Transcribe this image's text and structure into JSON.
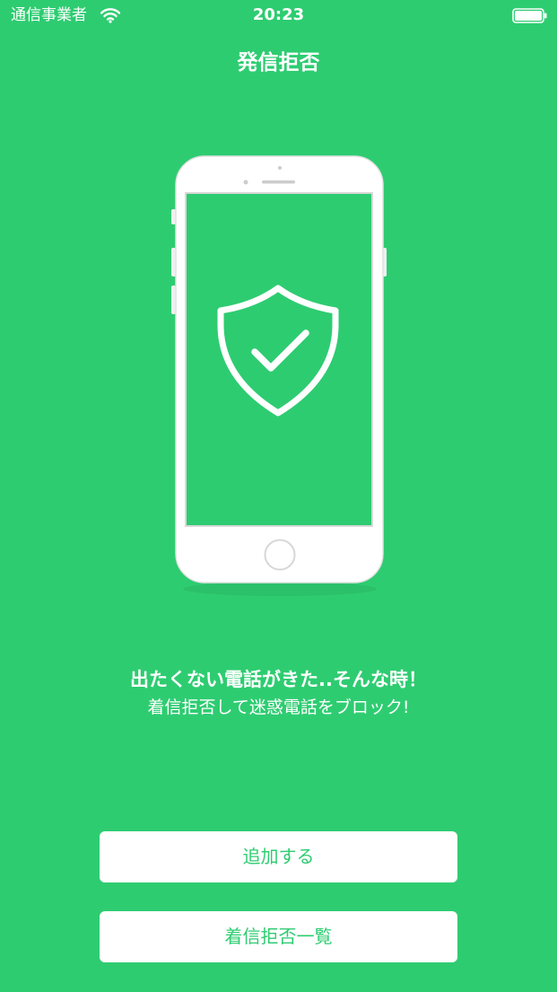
{
  "status_bar": {
    "carrier": "通信事業者",
    "time": "20:23",
    "wifi_icon": "wifi-icon",
    "battery_icon": "battery-full-icon"
  },
  "nav": {
    "title": "発信拒否"
  },
  "hero": {
    "illustration": "smartphone-with-shield-check",
    "headline": "出たくない電話がきた..そんな時！",
    "subline": "着信拒否して迷惑電話をブロック!"
  },
  "actions": {
    "add_label": "追加する",
    "list_label": "着信拒否一覧"
  },
  "colors": {
    "background": "#2ecc71",
    "button_bg": "#ffffff",
    "button_text": "#2ecc71",
    "text": "#ffffff"
  }
}
